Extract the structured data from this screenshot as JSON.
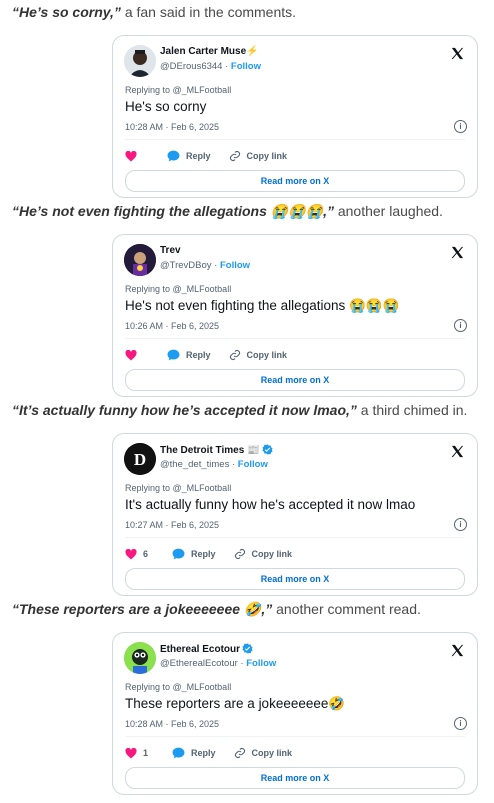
{
  "quotes": [
    {
      "bold": "“He’s so corny,”",
      "rest": " a fan said in the comments."
    },
    {
      "bold": "“He’s not even fighting the allegations 😭😭😭,”",
      "rest": " another laughed."
    },
    {
      "bold": "“It’s actually funny how he’s accepted it now lmao,”",
      "rest": " a third chimed in."
    },
    {
      "bold": "“These reporters are a jokeeeeeee 🤣,”",
      "rest": " another comment read."
    }
  ],
  "embed": {
    "follow_label": "Follow",
    "reply_label": "Reply",
    "copy_link_label": "Copy link",
    "read_more_label": "Read more on X",
    "info_glyph": "i",
    "x_logo": "x-logo-icon"
  },
  "tweets": [
    {
      "name": "Jalen Carter Muse⚡",
      "handle": "@DErous6344",
      "replying": "Replying to @_MLFootball",
      "text": "He's so corny",
      "time": "10:28 AM · Feb 6, 2025",
      "likes": "",
      "verified": false
    },
    {
      "name": "Trev",
      "handle": "@TrevDBoy",
      "replying": "Replying to @_MLFootball",
      "text": "He's not even fighting the allegations 😭😭😭",
      "time": "10:26 AM · Feb 6, 2025",
      "likes": "",
      "verified": false
    },
    {
      "name": "The Detroit Times 📰",
      "handle": "@the_det_times",
      "replying": "Replying to @_MLFootball",
      "text": "It's actually funny how he's accepted it now lmao",
      "time": "10:27 AM · Feb 6, 2025",
      "likes": "6",
      "verified": true
    },
    {
      "name": "Ethereal Ecotour",
      "handle": "@EtherealEcotour",
      "replying": "Replying to @_MLFootball",
      "text": "These reporters are a jokeeeeeee🤣",
      "time": "10:28 AM · Feb 6, 2025",
      "likes": "1",
      "verified": true
    }
  ]
}
